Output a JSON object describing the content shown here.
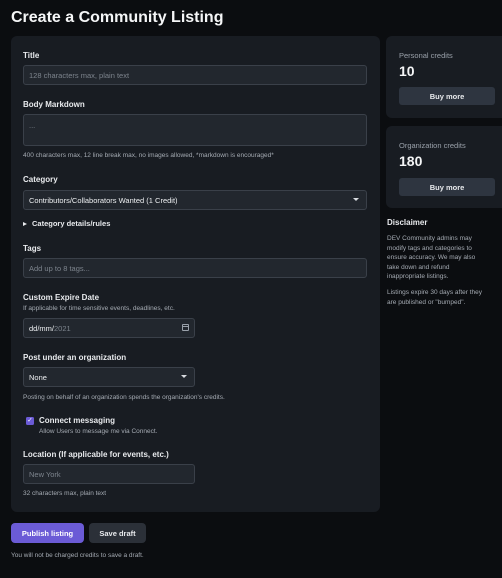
{
  "page": {
    "title": "Create a Community Listing"
  },
  "form": {
    "title_label": "Title",
    "title_placeholder": "128 characters max, plain text",
    "body_label": "Body Markdown",
    "body_placeholder": "...",
    "body_help": "400 characters max, 12 line break max, no images allowed, *markdown is encouraged*",
    "category_label": "Category",
    "category_value": "Contributors/Collaborators Wanted (1 Credit)",
    "category_details": "Category details/rules",
    "tags_label": "Tags",
    "tags_placeholder": "Add up to 8 tags...",
    "expire_label": "Custom Expire Date",
    "expire_help": "If applicable for time sensitive events, deadlines, etc.",
    "expire_date_format": "dd/mm/",
    "expire_year": "2021",
    "org_label": "Post under an organization",
    "org_value": "None",
    "org_help": "Posting on behalf of an organization spends the organization's credits.",
    "messaging_label": "Connect messaging",
    "messaging_help": "Allow Users to message me via Connect.",
    "messaging_checked": true,
    "location_label": "Location (If applicable for events, etc.)",
    "location_placeholder": "New York",
    "location_help": "32 characters max, plain text"
  },
  "sidebar": {
    "personal_label": "Personal credits",
    "personal_value": "10",
    "personal_button": "Buy more",
    "org_label": "Organization credits",
    "org_value": "180",
    "org_button": "Buy more",
    "disclaimer_title": "Disclaimer",
    "disclaimer_lines": [
      "DEV Community admins may",
      "modify tags and categories to",
      "ensure accuracy. We may also",
      "take down and refund",
      "inappropriate listings."
    ],
    "expire_lines": [
      "Listings expire 30 days after they",
      "are published or \"bumped\"."
    ]
  },
  "actions": {
    "publish": "Publish listing",
    "save_draft": "Save draft",
    "footnote": "You will not be charged credits to save a draft."
  },
  "colors": {
    "accent": "#6b5bd6",
    "background": "#0b0d10",
    "card": "#181c22"
  }
}
